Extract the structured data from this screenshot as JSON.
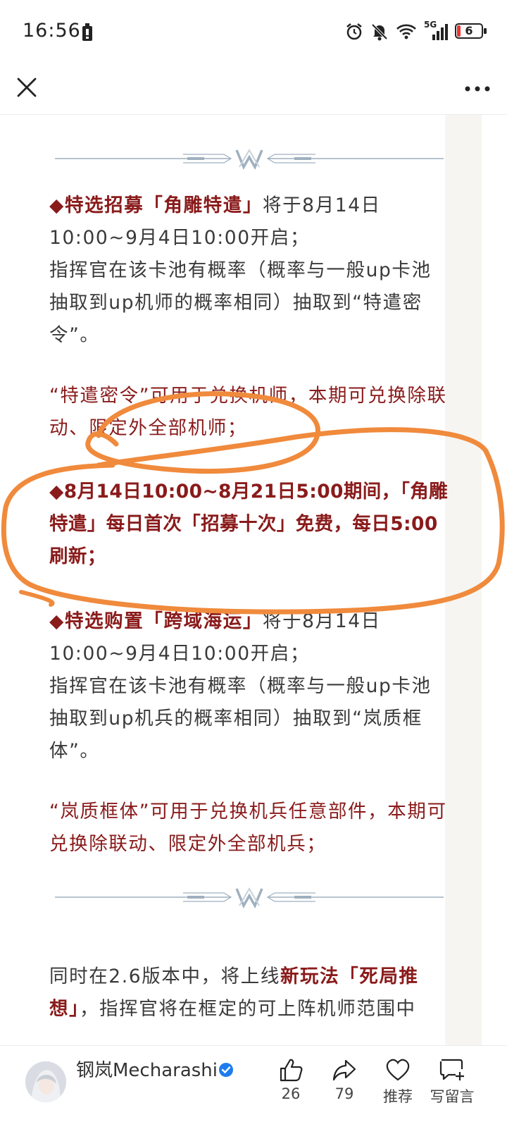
{
  "status_bar": {
    "time": "16:56",
    "network": "5G",
    "battery": "6",
    "icons": [
      "battery-saver-icon",
      "alarm-icon",
      "mute-icon",
      "wifi-icon",
      "signal-icon",
      "battery-icon"
    ]
  },
  "top_bar": {
    "close_icon": "close-icon",
    "more_icon": "more-icon"
  },
  "article": {
    "p1_title": "◆特选招募「角雕特遣」",
    "p1_rest": "将于8月14日10:00~9月4日10:00开启；",
    "p1_body": "指挥官在该卡池有概率（概率与一般up卡池抽取到up机师的概率相同）抽取到“特遣密令”。",
    "p2_red": "“特遣密令”可用于兑换机师，本期可兑换除联动、限定外全部机师；",
    "p3_bold": "◆8月14日10:00~8月21日5:00期间，「角雕特遣」每日首次「招募十次」免费，每日5:00刷新；",
    "p4_title": "◆特选购置「跨域海运」",
    "p4_rest": "将于8月14日10:00~9月4日10:00开启；",
    "p4_body": "指挥官在该卡池有概率（概率与一般up卡池抽取到up机兵的概率相同）抽取到“岚质框体”。",
    "p5_red": "“岚质框体”可用于兑换机兵任意部件，本期可兑换除联动、限定外全部机兵；",
    "p6_pre": "同时在2.6版本中，将上线",
    "p6_bold": "新玩法「死局推想」",
    "p6_post": "，指挥官将在框定的可上阵机师范围中"
  },
  "bottom_bar": {
    "author_name": "钢岚Mecharashi",
    "like_count": "26",
    "share_count": "79",
    "recommend_label": "推荐",
    "comment_label": "写留言"
  },
  "colors": {
    "accent_red": "#8a1b1b",
    "annotation_orange": "#f08a3c",
    "verified_blue": "#1e7cf0"
  }
}
